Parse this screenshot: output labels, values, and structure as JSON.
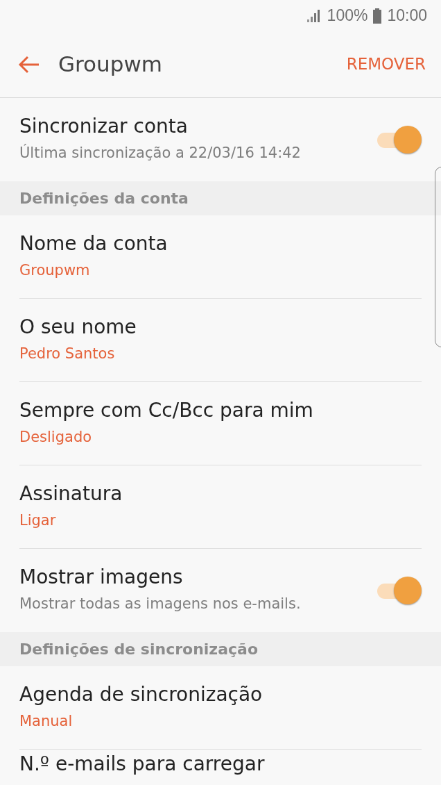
{
  "status_bar": {
    "battery": "100%",
    "time": "10:00"
  },
  "app_bar": {
    "title": "Groupwm",
    "action": "REMOVER"
  },
  "items": [
    {
      "kind": "toggle",
      "title": "Sincronizar conta",
      "subtitle": "Última sincronização a 22/03/16 14:42",
      "on": true
    },
    {
      "kind": "header",
      "title": "Definições da conta"
    },
    {
      "kind": "value",
      "title": "Nome da conta",
      "value": "Groupwm"
    },
    {
      "kind": "value",
      "title": "O seu nome",
      "value": "Pedro Santos"
    },
    {
      "kind": "value",
      "title": "Sempre com Cc/Bcc para mim",
      "value": "Desligado"
    },
    {
      "kind": "value",
      "title": "Assinatura",
      "value": "Ligar"
    },
    {
      "kind": "toggle",
      "title": "Mostrar imagens",
      "subtitle": "Mostrar todas as imagens nos e-mails.",
      "on": true
    },
    {
      "kind": "header",
      "title": "Definições de sincronização"
    },
    {
      "kind": "value",
      "title": "Agenda de sincronização",
      "value": "Manual"
    },
    {
      "kind": "value",
      "title": "N.º e-mails para carregar"
    }
  ]
}
